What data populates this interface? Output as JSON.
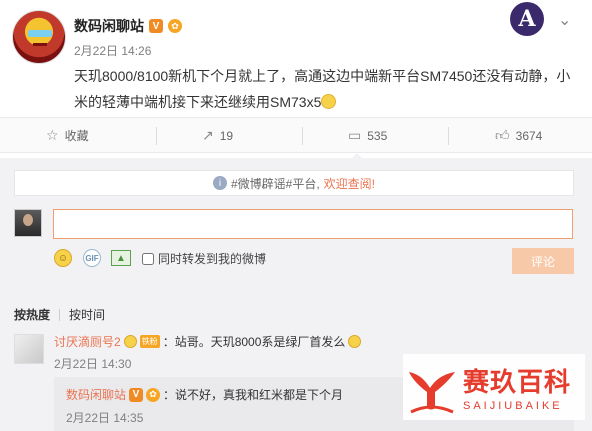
{
  "post": {
    "author": "数码闲聊站",
    "verified_badge": "V",
    "time": "2月22日 14:26",
    "text": "天玑8000/8100新机下个月就上了，高通这边中端新平台SM7450还没有动静，小米的轻薄中端机接下来还继续用SM73x5",
    "emoji_icon": "smile-emoji-icon"
  },
  "actions": {
    "favorite_label": "收藏",
    "repost_count": "19",
    "comment_count": "535",
    "like_count": "3674"
  },
  "composer": {
    "notice_prefix": "#微博辟谣#平台,",
    "notice_link": "欢迎查阅!",
    "input_value": "",
    "repost_checkbox_label": "同时转发到我的微博",
    "submit_label": "评论"
  },
  "sort": {
    "hot_label": "按热度",
    "time_label": "按时间"
  },
  "comments": [
    {
      "user": "讨厌滴厕号2",
      "fan_badge": "铁粉",
      "text": "：站哥。天玑8000系是绿厂首发么",
      "time": "2月22日 14:30",
      "reply": {
        "user": "数码闲聊站",
        "text": "：说不好，真我和红米都是下个月",
        "time": "2月22日 14:35"
      }
    }
  ],
  "watermark": {
    "name_cn": "赛玖百科",
    "name_en": "SAIJIUBAIKE"
  },
  "colors": {
    "accent_orange": "#eb7350",
    "verified": "#f08a24",
    "watermark_red": "#e53c2d",
    "panel_bg": "#f2f2f5"
  }
}
